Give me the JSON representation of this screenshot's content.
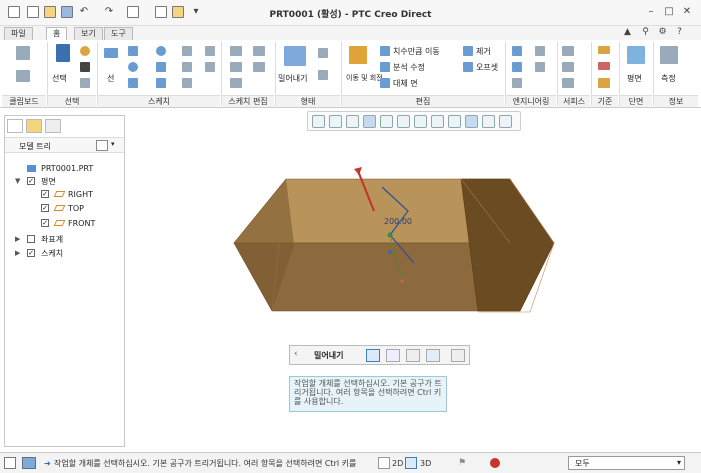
{
  "app": {
    "title": "PRT0001 (활성) - PTC Creo Direct"
  },
  "menu_tabs": [
    "파일",
    "홈",
    "보기",
    "도구"
  ],
  "ribbon": {
    "groups": [
      "클립보드",
      "선택",
      "스케치",
      "스케치 편집",
      "형태",
      "편집",
      "엔지니어링",
      "서피스",
      "기준",
      "단면",
      "정보"
    ],
    "buttons": {
      "select": "선택",
      "line": "선",
      "extrude": "밀어내기",
      "move_rotate": "이동 및 회전",
      "dim_move": "치수만큼 이동",
      "analysis_edit": "분석 수정",
      "replace": "대체 면",
      "remove": "제거",
      "offset": "오프셋",
      "plane": "평면",
      "measure": "측정"
    }
  },
  "model_tree": {
    "header": "모델 트리",
    "items": [
      {
        "label": "PRT0001.PRT"
      },
      {
        "label": "평면"
      },
      {
        "label": "RIGHT"
      },
      {
        "label": "TOP"
      },
      {
        "label": "FRONT"
      },
      {
        "label": "좌표계"
      },
      {
        "label": "스케치"
      }
    ]
  },
  "canvas": {
    "dimension": "200.00"
  },
  "dashboard": {
    "title": "밀어내기"
  },
  "tooltip": {
    "text": "작업할 개체를 선택하십시오. 기본 공구가 트리거됩니다. 여러 항목을 선택하려면 Ctrl 키를 사용합니다."
  },
  "status": {
    "message": "작업할 개체를 선택하십시오. 기본 공구가 트리거됩니다. 여러 항목을 선택하려면 Ctrl 키를",
    "mode2d": "2D",
    "mode3d": "3D",
    "filter": "모두"
  },
  "colors": {
    "accent": "#2e6fb5",
    "part": "#8c6a3d",
    "highlight": "#c0392b"
  }
}
